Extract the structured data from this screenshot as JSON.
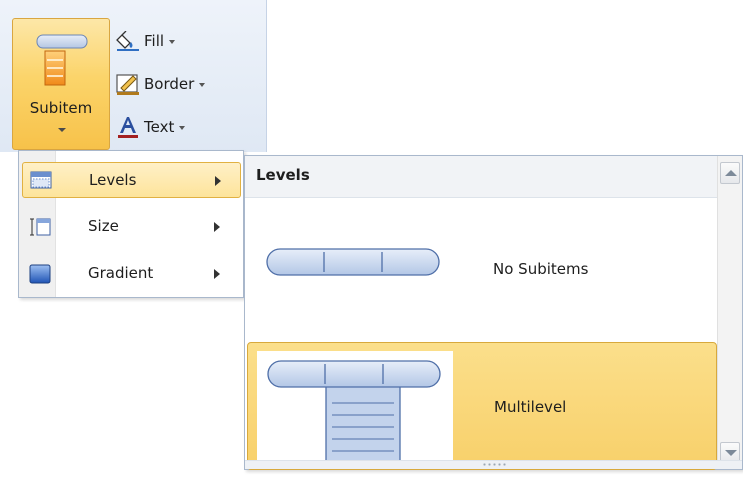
{
  "ribbon": {
    "subitem_label": "Subitem",
    "fill_label": "Fill",
    "border_label": "Border",
    "text_label": "Text"
  },
  "menu": {
    "items": [
      {
        "label": "Levels",
        "icon": "levels-icon",
        "highlighted": true
      },
      {
        "label": "Size",
        "icon": "size-icon",
        "highlighted": false
      },
      {
        "label": "Gradient",
        "icon": "gradient-icon",
        "highlighted": false
      }
    ]
  },
  "gallery": {
    "header": "Levels",
    "items": [
      {
        "label": "No Subitems",
        "selected": false
      },
      {
        "label": "Multilevel",
        "selected": true
      }
    ]
  },
  "colors": {
    "accent_gold": "#f8d06a",
    "highlight_border": "#d8a93c",
    "shape_blue": "#b8cbe8",
    "shape_stroke": "#4f6fa8"
  }
}
